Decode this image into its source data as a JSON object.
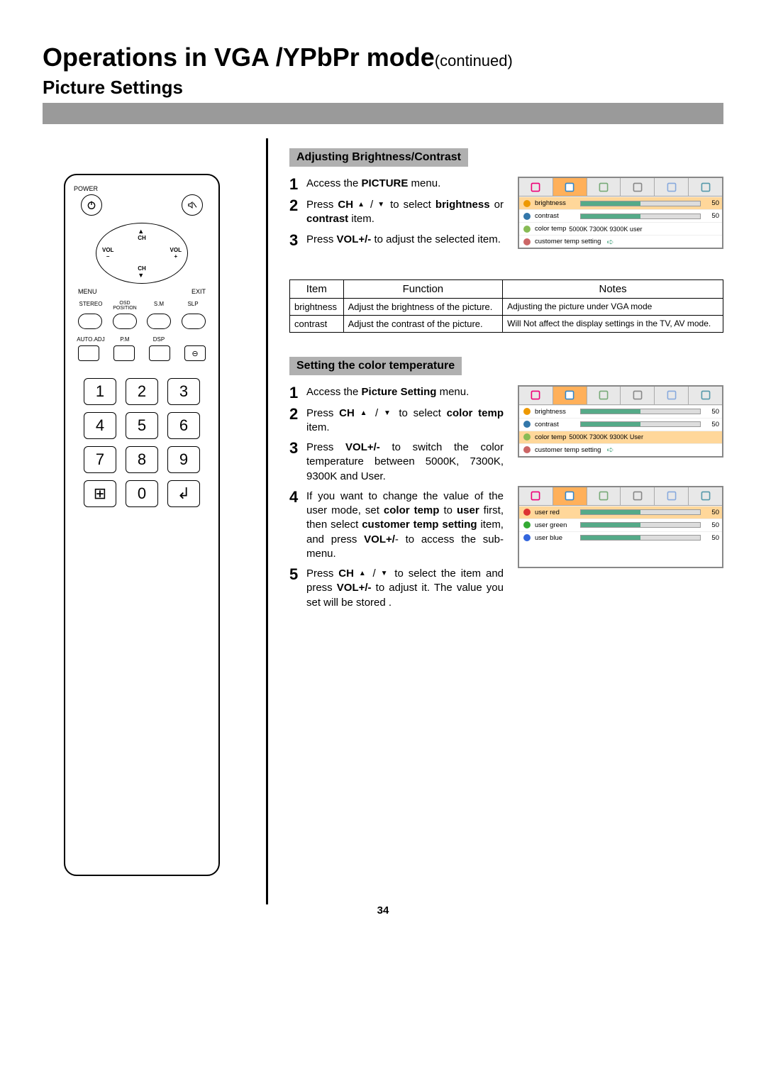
{
  "title_main": "Operations in VGA /YPbPr mode",
  "title_cont": "(continued)",
  "subtitle": "Picture Settings",
  "page_number": "34",
  "remote": {
    "power": "POWER",
    "ch": "CH",
    "vol_minus": "VOL\n–",
    "vol_plus": "VOL\n+",
    "menu": "MENU",
    "exit": "EXIT",
    "row4": [
      "STEREO",
      "OSD\nPOSITION",
      "S.M",
      "SLP"
    ],
    "row4b": [
      "AUTO.ADJ",
      "P.M",
      "DSP",
      ""
    ],
    "numpad": [
      "1",
      "2",
      "3",
      "4",
      "5",
      "6",
      "7",
      "8",
      "9",
      "⊞",
      "0",
      "↲"
    ]
  },
  "section1": {
    "header": "Adjusting Brightness/Contrast",
    "steps": [
      {
        "n": "1",
        "html": "Access the <b>PICTURE</b> menu."
      },
      {
        "n": "2",
        "html": "Press <b>CH</b> <span class='tri-inline'>▲</span> / <span class='tri-inline'>▼</span> to select <b>brightness</b> or <b>contrast</b> item."
      },
      {
        "n": "3",
        "html": "Press <b>VOL+/-</b> to adjust the selected item."
      }
    ]
  },
  "osd1": {
    "rows": [
      {
        "icon": "sun",
        "label": "brightness",
        "bar": 50,
        "val": "50",
        "hl": true
      },
      {
        "icon": "moon",
        "label": "contrast",
        "bar": 50,
        "val": "50"
      },
      {
        "icon": "palette",
        "label": "color temp",
        "opts": "5000K 7300K 9300K user"
      },
      {
        "icon": "user",
        "label": "customer temp setting",
        "arrow": true
      }
    ]
  },
  "func_table": {
    "headers": [
      "Item",
      "Function",
      "Notes"
    ],
    "rows": [
      {
        "item": "brightness",
        "func": "Adjust the brightness of the picture.",
        "notes": "Adjusting the picture under VGA mode"
      },
      {
        "item": "contrast",
        "func": "Adjust the contrast of the picture.",
        "notes": "Will Not affect the display settings in the TV, AV mode."
      }
    ]
  },
  "section2": {
    "header": "Setting the color temperature",
    "steps": [
      {
        "n": "1",
        "html": "Access the <b>Picture Setting</b> menu."
      },
      {
        "n": "2",
        "html": "Press <b>CH</b> <span class='tri-inline'>▲</span> / <span class='tri-inline'>▼</span> to select <b>color temp</b> item."
      },
      {
        "n": "3",
        "html": "Press <b>VOL+/-</b> to switch the color temperature between 5000K, 7300K, 9300K and User."
      },
      {
        "n": "4",
        "html": "If you want to change the value of the user mode, set <b>color temp</b> to <b>user</b> first, then select <b>customer temp setting</b> item, and press <b>VOL+/</b>- to access the sub-menu."
      },
      {
        "n": "5",
        "html": "Press <b>CH</b> <span class='tri-inline'>▲</span> / <span class='tri-inline'>▼</span> to select the item and press <b>VOL+/-</b> to adjust it. The value you set will be stored ."
      }
    ]
  },
  "osd2": {
    "rows": [
      {
        "icon": "sun",
        "label": "brightness",
        "bar": 50,
        "val": "50"
      },
      {
        "icon": "moon",
        "label": "contrast",
        "bar": 50,
        "val": "50"
      },
      {
        "icon": "palette",
        "label": "color temp",
        "opts": "5000K 7300K 9300K User",
        "hl": true
      },
      {
        "icon": "user",
        "label": "customer temp setting",
        "arrow": true
      }
    ]
  },
  "osd3": {
    "rows": [
      {
        "icon": "red",
        "label": "user red",
        "bar": 50,
        "val": "50",
        "hl": true
      },
      {
        "icon": "green",
        "label": "user green",
        "bar": 50,
        "val": "50"
      },
      {
        "icon": "blue",
        "label": "user blue",
        "bar": 50,
        "val": "50"
      }
    ]
  }
}
